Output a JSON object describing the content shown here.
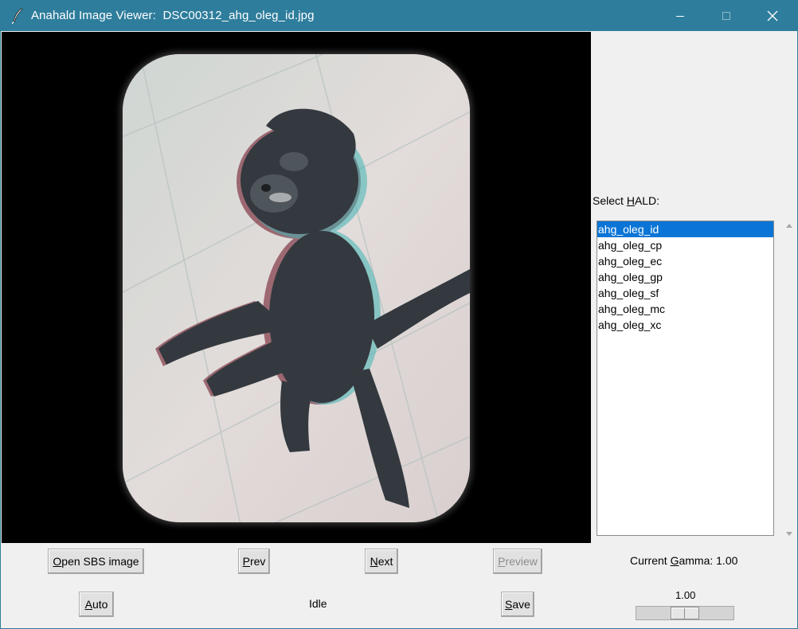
{
  "window": {
    "title": "Anahald Image Viewer:  DSC00312_ahg_oleg_id.jpg"
  },
  "hald": {
    "label": "Select HALD:",
    "label_prefix": "Select ",
    "label_mnemonic": "H",
    "label_suffix": "ALD:",
    "items": [
      "ahg_oleg_id",
      "ahg_oleg_cp",
      "ahg_oleg_ec",
      "ahg_oleg_gp",
      "ahg_oleg_sf",
      "ahg_oleg_mc",
      "ahg_oleg_xc"
    ],
    "selected_index": 0
  },
  "buttons": {
    "open": {
      "mn": "O",
      "rest": "pen SBS image"
    },
    "prev": {
      "mn": "P",
      "rest": "rev"
    },
    "next": {
      "mn": "N",
      "rest": "ext"
    },
    "preview": {
      "mn": "P",
      "rest": "review",
      "disabled": true
    },
    "auto": {
      "mn": "A",
      "rest": "uto"
    },
    "save": {
      "mn": "S",
      "rest": "ave"
    }
  },
  "status": "Idle",
  "gamma": {
    "label_prefix": "Current ",
    "label_mnemonic": "G",
    "label_suffix": "amma: 1.00",
    "slider_value_text": "1.00",
    "slider_fraction": 0.5
  },
  "colors": {
    "titlebar": "#2e7d9c",
    "selection": "#0a75d6"
  },
  "icons": {
    "app": "feather-icon",
    "minimize": "minimize-icon",
    "maximize": "maximize-icon",
    "close": "close-icon"
  }
}
